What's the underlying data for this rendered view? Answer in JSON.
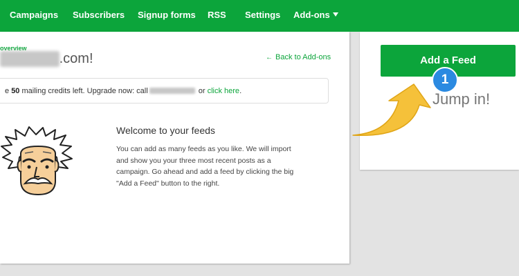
{
  "nav": {
    "items": [
      "Campaigns",
      "Subscribers",
      "Signup forms",
      "RSS",
      "Settings"
    ],
    "addons_label": "Add-ons",
    "bg_color": "#0ca53b"
  },
  "main": {
    "overview_label": "overview",
    "site_name_blurred": "s1hosting",
    "site_suffix": ".com!",
    "back_link": "Back to Add-ons",
    "credits": {
      "prefix": "e ",
      "count": "50",
      "middle": " mailing credits left. Upgrade now: call",
      "or": " or ",
      "link": "click here",
      "end": "."
    },
    "welcome_title": "Welcome to your feeds",
    "welcome_body": "You can add as many feeds as you like. We will import and show you your three most recent posts as a campaign. Go ahead and add a feed by clicking the big \"Add a Feed\" button to the right."
  },
  "side": {
    "add_feed_label": "Add a Feed",
    "step_number": "1",
    "jump_in": "Jump in!"
  },
  "colors": {
    "accent": "#0ca53b",
    "badge": "#2b8ae1",
    "arrow": "#f5c13a"
  }
}
